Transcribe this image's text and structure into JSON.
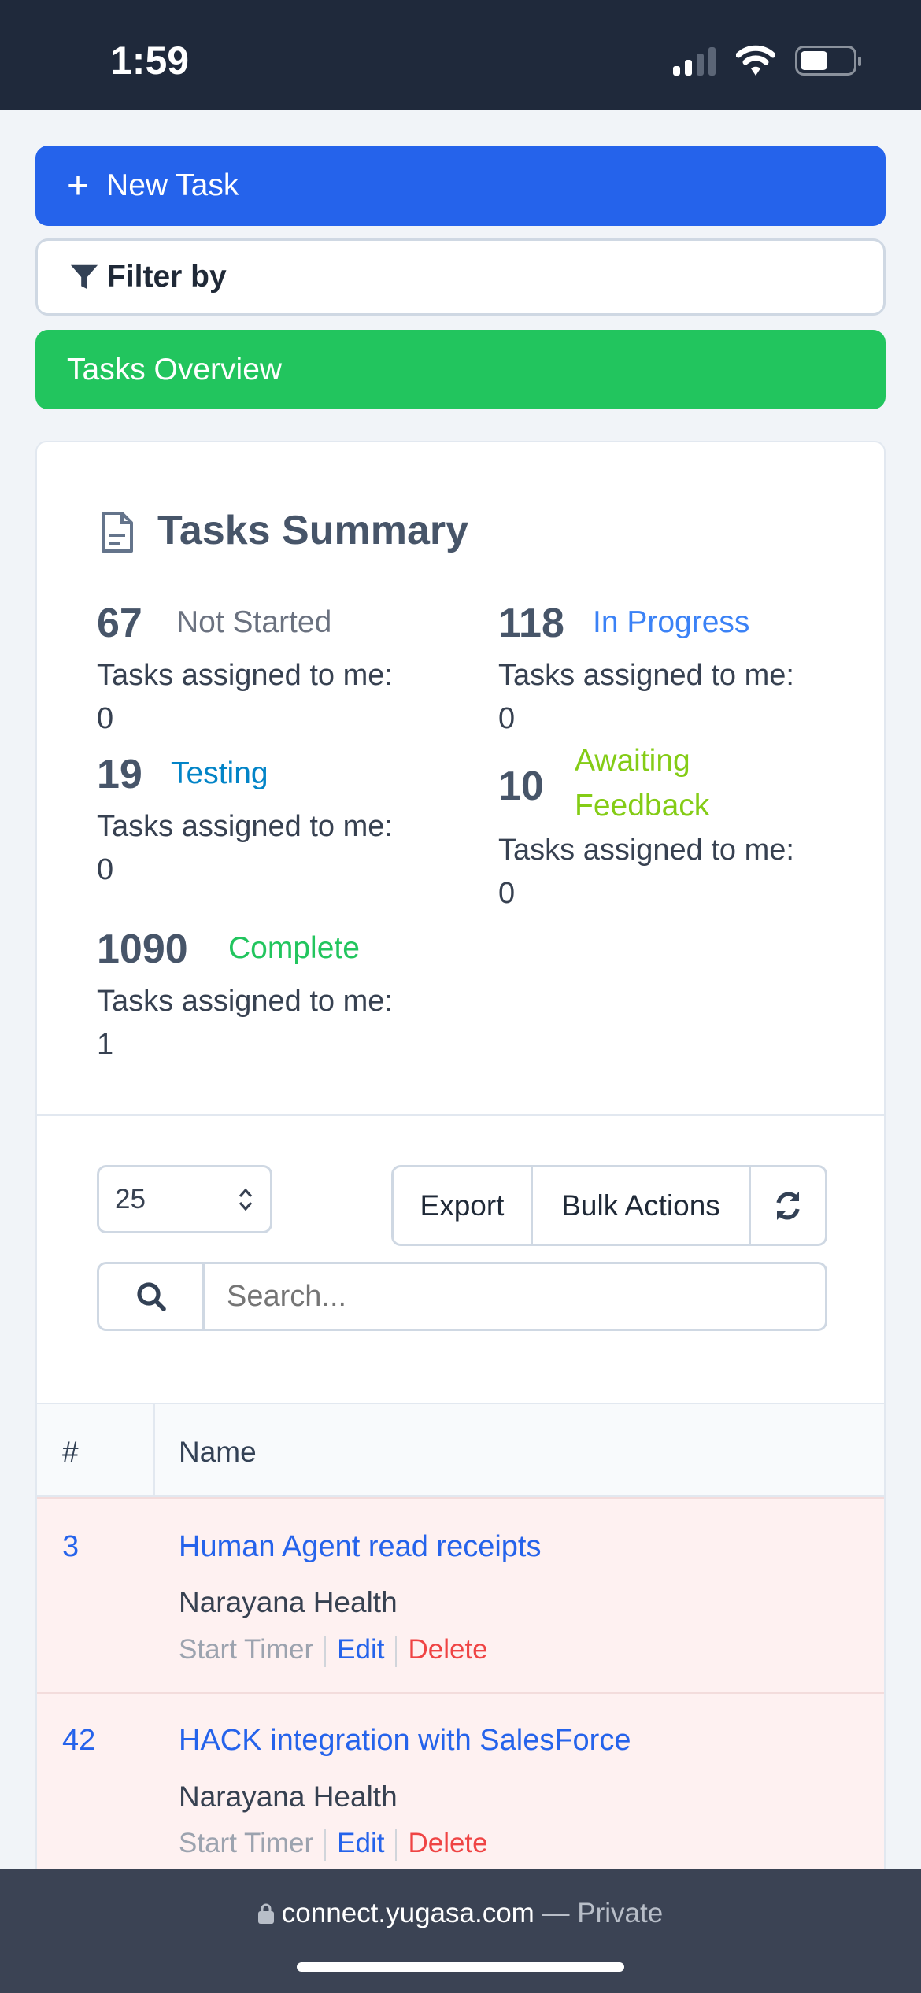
{
  "status_bar": {
    "time": "1:59",
    "icons": [
      "signal-icon",
      "wifi-icon",
      "battery-icon"
    ]
  },
  "buttons": {
    "new_task": "New Task",
    "filter": "Filter by",
    "overview": "Tasks Overview"
  },
  "summary": {
    "title": "Tasks Summary",
    "assigned_label": "Tasks assigned to me:",
    "items": [
      {
        "count": "67",
        "status": "Not Started",
        "assigned": "0",
        "color": "#6b7280"
      },
      {
        "count": "118",
        "status": "In Progress",
        "assigned": "0",
        "color": "#3b82f6"
      },
      {
        "count": "19",
        "status": "Testing",
        "assigned": "0",
        "color": "#0284c7"
      },
      {
        "count": "10",
        "status": "Awaiting Feedback",
        "status_line1": "Awaiting",
        "status_line2": "Feedback",
        "assigned": "0",
        "color": "#84cc16"
      },
      {
        "count": "1090",
        "status": "Complete",
        "assigned": "1",
        "color": "#22c55e"
      }
    ]
  },
  "toolbar": {
    "page_size": "25",
    "export": "Export",
    "bulk_actions": "Bulk Actions",
    "search_placeholder": "Search..."
  },
  "table": {
    "columns": [
      "#",
      "Name"
    ],
    "rows": [
      {
        "id": "3",
        "name": "Human Agent read receipts",
        "project": "Narayana Health"
      },
      {
        "id": "42",
        "name": "HACK integration with SalesForce",
        "project": "Narayana Health"
      }
    ],
    "actions": {
      "start_timer": "Start Timer",
      "edit": "Edit",
      "delete": "Delete"
    }
  },
  "browser": {
    "url": "connect.yugasa.com",
    "private": "— Private"
  }
}
